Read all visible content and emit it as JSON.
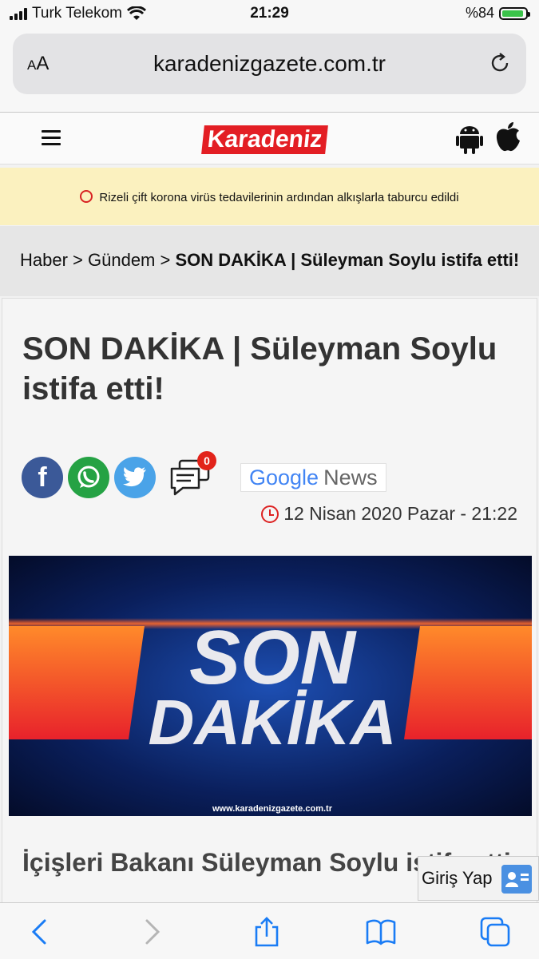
{
  "status_bar": {
    "carrier": "Turk Telekom",
    "time": "21:29",
    "battery": "%84"
  },
  "browser": {
    "text_size_label": "AA",
    "url": "karadenizgazete.com.tr"
  },
  "site": {
    "logo_text": "Karadeniz"
  },
  "ticker": {
    "text": "Rizeli çift korona virüs tedavilerinin ardından alkışlarla taburcu edildi"
  },
  "breadcrumb": {
    "part1": "Haber",
    "sep1": " > ",
    "part2": "Gündem",
    "sep2": " > ",
    "current": "SON DAKİKA | Süleyman Soylu istifa etti!"
  },
  "article": {
    "title": "SON DAKİKA | Süleyman Soylu istifa etti!",
    "comment_count": "0",
    "google_news_label": "Google",
    "google_news_suffix": "News",
    "date": "12 Nisan 2020 Pazar - 21:22",
    "lead": "İçişleri Bakanı Süleyman Soylu istifa etti."
  },
  "hero": {
    "line1": "SON",
    "line2": "DAKİKA",
    "watermark": "www.karadenizgazete.com.tr"
  },
  "login": {
    "label": "Giriş Yap"
  }
}
